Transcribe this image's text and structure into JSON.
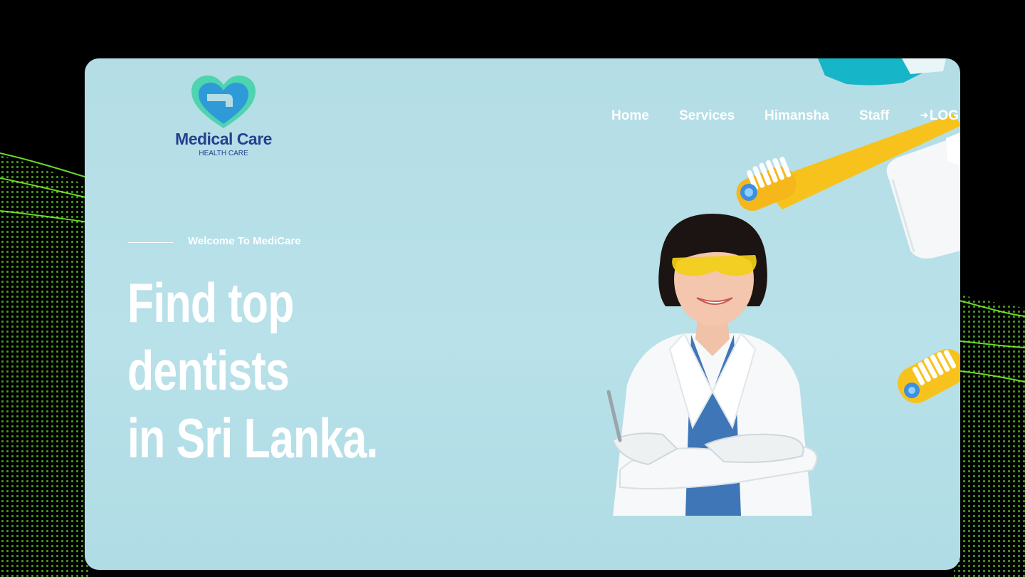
{
  "logo": {
    "title": "Medical Care",
    "subtitle": "HEALTH CARE"
  },
  "nav": {
    "items": [
      {
        "label": "Home"
      },
      {
        "label": "Services"
      },
      {
        "label": "Himansha"
      },
      {
        "label": "Staff"
      }
    ],
    "login_label": "LOG",
    "login_icon": "login-icon"
  },
  "hero": {
    "welcome": "Welcome To MediCare",
    "heading": [
      "Find top",
      "dentists",
      "in Sri Lanka."
    ]
  },
  "colors": {
    "page_background": "#000000",
    "card_background": "#b4dde5",
    "logo_blue": "#263f8f",
    "logo_teal": "#4fd4b0",
    "text_white": "#ffffff",
    "toothbrush_yellow": "#f7c21c",
    "wave_green": "#6edb2a"
  }
}
